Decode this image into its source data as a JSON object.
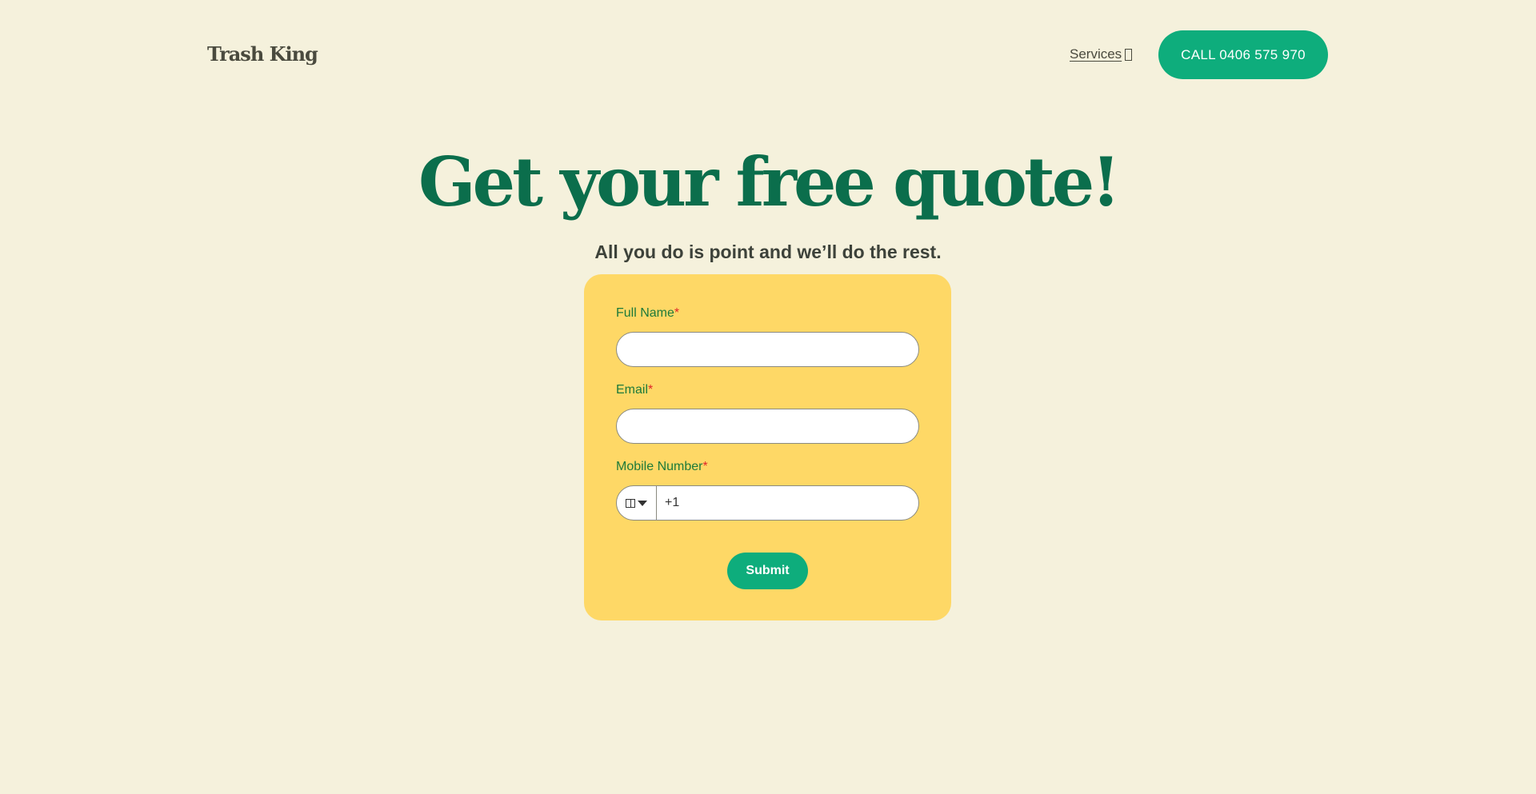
{
  "header": {
    "logo": "Trash King",
    "services_label": "Services",
    "services_icon": "external-link-icon",
    "call_label": "CALL 0406 575 970"
  },
  "hero": {
    "title": "Get your free quote!",
    "subtitle": "All you do is point and we’ll do the rest."
  },
  "form": {
    "full_name_label": "Full Name",
    "email_label": "Email",
    "mobile_label": "Mobile Number",
    "required_mark": "*",
    "full_name_value": "",
    "email_value": "",
    "phone_value": "+1",
    "country_icon": "flag-icon",
    "submit_label": "Submit"
  },
  "colors": {
    "background": "#f5f1dc",
    "accent": "#0ead7c",
    "title": "#0b6e4c",
    "card": "#fed866",
    "label": "#1d7a3a",
    "required": "#e0262a"
  }
}
